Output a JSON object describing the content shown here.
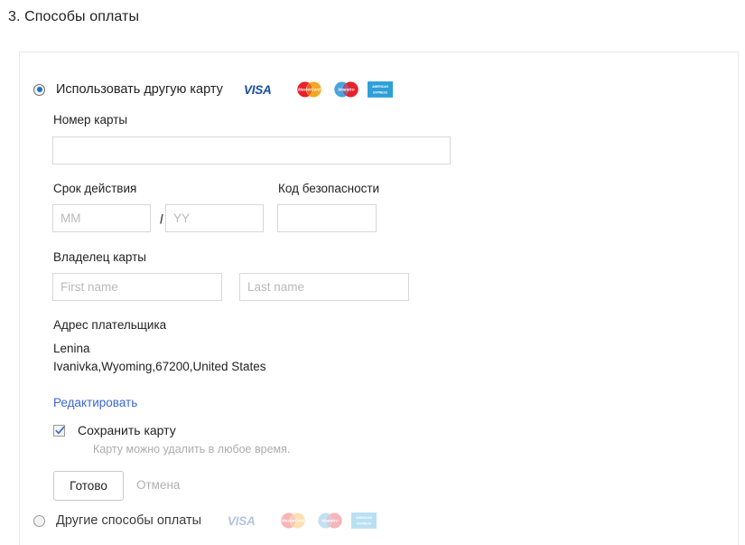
{
  "page": {
    "title": "3. Способы оплаты"
  },
  "card_logos": [
    {
      "name": "visa-logo",
      "label": "VISA"
    },
    {
      "name": "mastercard-logo",
      "label": "MasterCard"
    },
    {
      "name": "maestro-logo",
      "label": "Maestro"
    },
    {
      "name": "amex-logo",
      "label": "AMERICAN EXPRESS"
    }
  ],
  "options": {
    "use_another_card": {
      "label": "Использовать другую карту",
      "selected": true
    },
    "other_methods": {
      "label": "Другие способы оплаты",
      "selected": false
    }
  },
  "form": {
    "card_number": {
      "label": "Номер карты",
      "value": "",
      "placeholder": ""
    },
    "expiry": {
      "label": "Срок действия",
      "month": {
        "value": "",
        "placeholder": "MM"
      },
      "separator": "/",
      "year": {
        "value": "",
        "placeholder": "YY"
      }
    },
    "security_code": {
      "label": "Код безопасности",
      "value": "",
      "placeholder": ""
    },
    "card_holder": {
      "label": "Владелец карты",
      "first_name": {
        "value": "",
        "placeholder": "First name"
      },
      "last_name": {
        "value": "",
        "placeholder": "Last name"
      }
    },
    "billing_address": {
      "label": "Адрес плательщика",
      "line1": "Lenina",
      "line2": "Ivanivka,Wyoming,67200,United States",
      "edit_link": "Редактировать"
    },
    "save_card": {
      "label": "Сохранить карту",
      "checked": true,
      "hint": "Карту можно удалить в любое время."
    },
    "actions": {
      "done": "Готово",
      "cancel": "Отмена"
    }
  },
  "colors": {
    "link": "#3b67d6",
    "radio_dot": "#1a73c8",
    "border": "#d8d8d8",
    "placeholder": "#b9b9b9",
    "hint": "#adadad"
  }
}
